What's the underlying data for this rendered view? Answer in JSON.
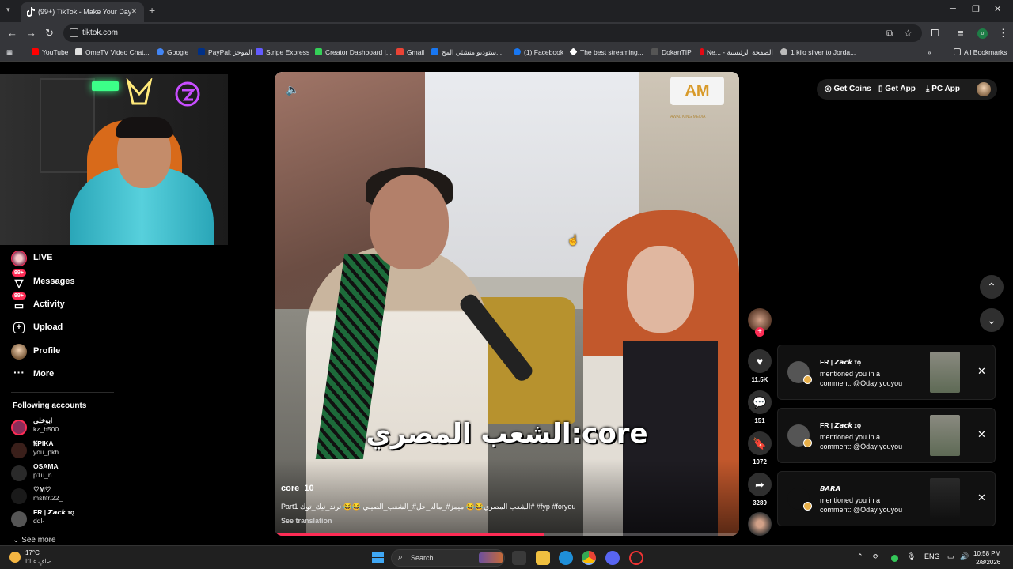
{
  "browser": {
    "tab_title": "(99+) TikTok - Make Your Day",
    "url": "tiktok.com",
    "bookmarks": [
      {
        "label": "YouTube",
        "color": "#ff0000"
      },
      {
        "label": "OmeTV Video Chat...",
        "color": "#e0e0e0"
      },
      {
        "label": "Google",
        "color": "#4285f4"
      },
      {
        "label": "PayPal: الموجز",
        "color": "#003087"
      },
      {
        "label": "Stripe Express",
        "color": "#635bff"
      },
      {
        "label": "Creator Dashboard |...",
        "color": "#34d058"
      },
      {
        "label": "Gmail",
        "color": "#ea4335"
      },
      {
        "label": "ستوديو منشئي المح...",
        "color": "#1877f2"
      },
      {
        "label": "(1) Facebook",
        "color": "#1877f2"
      },
      {
        "label": "The best streaming...",
        "color": "#ffffff"
      },
      {
        "label": "DokanTIP",
        "color": "#333333"
      },
      {
        "label": "Ne... - الصفحة الرئيسية",
        "color": "#e50914"
      },
      {
        "label": "1 kilo silver to Jorda...",
        "color": "#bbbbbb"
      }
    ],
    "all_bookmarks": "All Bookmarks"
  },
  "sidebar": {
    "nav": [
      {
        "label": "LIVE",
        "icon": "live-icon",
        "badge": ""
      },
      {
        "label": "Messages",
        "icon": "messages-icon",
        "badge": "99+"
      },
      {
        "label": "Activity",
        "icon": "activity-icon",
        "badge": "99+"
      },
      {
        "label": "Upload",
        "icon": "upload-icon",
        "badge": ""
      },
      {
        "label": "Profile",
        "icon": "profile-icon",
        "badge": ""
      },
      {
        "label": "More",
        "icon": "more-icon",
        "badge": ""
      }
    ],
    "following_title": "Following accounts",
    "accounts": [
      {
        "name": "ابوخلي",
        "handle": "kz_b500",
        "color": "#8a2d5a"
      },
      {
        "name": "ꝄPIKA",
        "handle": "you_pkh",
        "color": "#3a1f1a"
      },
      {
        "name": "OSAMA",
        "handle": "p1u_n",
        "color": "#2a2a2a"
      },
      {
        "name": "♡M♡",
        "handle": "mshfr.22_",
        "color": "#1a1a1a"
      },
      {
        "name": "FR | 𝙕𝙖𝙘𝙠 ɪǫ",
        "handle": "ddl-",
        "color": "#555555"
      }
    ],
    "see_more": "See more"
  },
  "video": {
    "caption_overlay": "الشعب المصري:core",
    "logo": "AM",
    "logo_sub": "AWAL KING MEDIA",
    "author": "core_10",
    "description": "Part1 الشعب المصري😂😂 ميمز#_ماله_حل#_الشعب_الصيني 😂😂 ترند_تيك_توك# #fyp #foryou",
    "see_translation": "See translation",
    "progress": 0.58
  },
  "actions": {
    "likes": "11.5K",
    "comments": "151",
    "saves": "1072",
    "shares": "3289"
  },
  "topbar": {
    "get_coins": "Get Coins",
    "get_app": "Get App",
    "pc_app": "PC App"
  },
  "notifications": [
    {
      "who": "FR | 𝙕𝙖𝙘𝙠 ɪǫ",
      "message": "mentioned you in a comment: @Oday youyou"
    },
    {
      "who": "FR | 𝙕𝙖𝙘𝙠 ɪǫ",
      "message": "mentioned you in a comment: @Oday youyou"
    },
    {
      "who": "𝘽𝘼𝙍𝘼",
      "message": "mentioned you in a comment: @Oday youyou"
    }
  ],
  "taskbar": {
    "temp": "17°C",
    "weather": "صافٍ غالبًا",
    "search": "Search",
    "lang": "ENG",
    "time": "10:58 PM",
    "date": "2/8/2026"
  }
}
